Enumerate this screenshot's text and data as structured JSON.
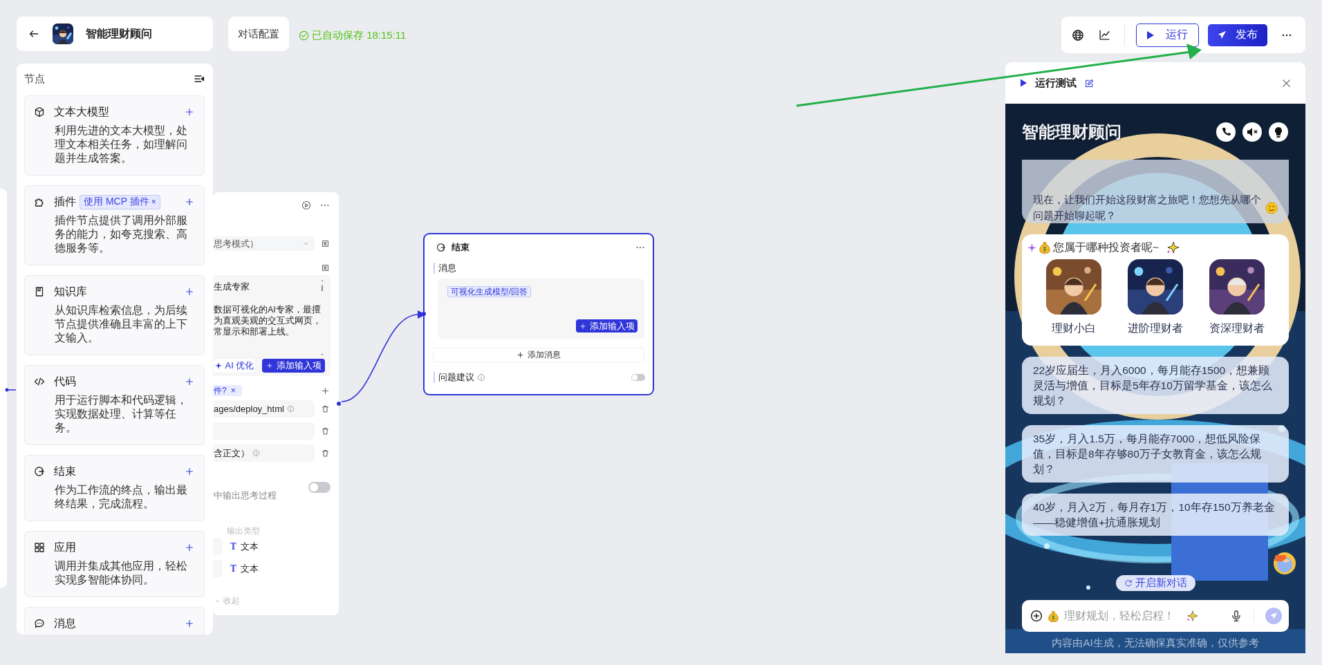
{
  "header": {
    "app_name": "智能理财顾问",
    "config_button": "对话配置",
    "save_status": "已自动保存 18:15:11"
  },
  "toolbar": {
    "run_button": "运行",
    "publish_button": "发布"
  },
  "node_panel": {
    "title": "节点",
    "items": [
      {
        "kind": "llm",
        "title": "文本大模型",
        "description": "利用先进的文本大模型，处理文本相关任务，如理解问题并生成答案。"
      },
      {
        "kind": "plugin",
        "title": "插件",
        "tag": "使用 MCP 插件",
        "tag_close": "×",
        "description": "插件节点提供了调用外部服务的能力，如夸克搜索、高德服务等。"
      },
      {
        "kind": "knowledge",
        "title": "知识库",
        "description": "从知识库检索信息，为后续节点提供准确且丰富的上下文输入。"
      },
      {
        "kind": "code",
        "title": "代码",
        "description": "用于运行脚本和代码逻辑，实现数据处理、计算等任务。"
      },
      {
        "kind": "end",
        "title": "结束",
        "description": "作为工作流的终点，输出最终结果，完成流程。"
      },
      {
        "kind": "app",
        "title": "应用",
        "description": "调用并集成其他应用，轻松实现多智能体协同。"
      },
      {
        "kind": "message",
        "title": "消息"
      }
    ]
  },
  "llm_node": {
    "model_select": "思考模式）",
    "prompt_lines": [
      "生成专家",
      "数据可视化的AI专家，最擅",
      "为直观美观的交互式网页，",
      "常显示和部署上线。"
    ],
    "ai_button": "AI 优化",
    "add_input_button": "添加输入项",
    "tool_tag": "件?",
    "tool_tag_close": "×",
    "params": [
      {
        "text": "ages/deploy_html",
        "info": true
      },
      {
        "info": false
      },
      {
        "text": "含正文）",
        "info": true
      }
    ],
    "think_label": "中输出思考过程",
    "think_on": false,
    "output_header": "输出类型",
    "outputs": [
      {
        "type_icon": "T",
        "type": "文本"
      },
      {
        "type_icon": "T",
        "type": "文本"
      }
    ],
    "collapse": "收起"
  },
  "end_node": {
    "title": "结束",
    "selected": true,
    "message_label": "消息",
    "message_tag": "可视化生成模型/回答",
    "add_input_button": "添加输入项",
    "add_message_button": "添加消息",
    "suggestion_label": "问题建议",
    "suggestion_on": false
  },
  "run_panel": {
    "title": "运行测试",
    "chat_title": "智能理财顾问",
    "bot_message": "现在，让我们开始这段财富之旅吧！您想先从哪个问题开始聊起呢？",
    "investor_prompt": "您属于哪种投资者呢~",
    "investor_types": [
      {
        "label": "理财小白"
      },
      {
        "label": "进阶理财者"
      },
      {
        "label": "资深理财者"
      }
    ],
    "suggestions": [
      "22岁应届生，月入6000，每月能存1500，想兼顾灵活与增值，目标是5年存10万留学基金，该怎么规划？",
      "35岁，月入1.5万，每月能存7000，想低风险保值，目标是8年存够80万子女教育金，该怎么规划？",
      "40岁，月入2万，每月存1万，10年存150万养老金——稳健增值+抗通胀规划"
    ],
    "new_chat_button": "开启新对话",
    "input_placeholder": "理财规划，轻松启程！",
    "disclaimer": "内容由AI生成，无法确保真实准确，仅供参考"
  }
}
